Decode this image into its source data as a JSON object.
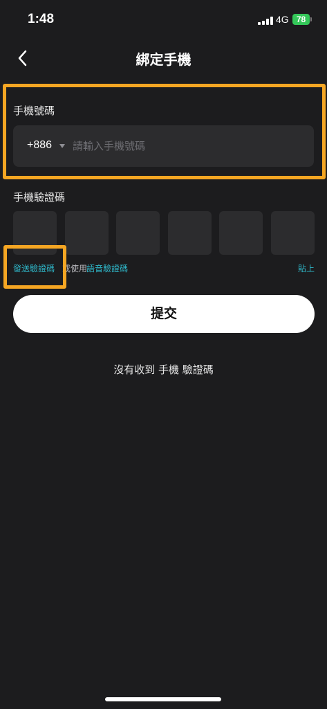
{
  "status_bar": {
    "time": "1:48",
    "network": "4G",
    "battery": "78"
  },
  "nav": {
    "title": "綁定手機"
  },
  "phone": {
    "label": "手機號碼",
    "country_code": "+886",
    "placeholder": "請輸入手機號碼",
    "value": ""
  },
  "verification": {
    "label": "手機驗證碼",
    "box_count": 6,
    "send_code": "發送驗證碼",
    "or_use": "或使用",
    "voice_code": "語音驗證碼",
    "paste": "貼上"
  },
  "submit": {
    "label": "提交"
  },
  "no_code": {
    "label": "沒有收到 手機 驗證碼"
  },
  "colors": {
    "background": "#1c1c1e",
    "field": "#2c2c2e",
    "accent_link": "#2fb7c9",
    "highlight": "#f5a623",
    "battery": "#34c759"
  }
}
